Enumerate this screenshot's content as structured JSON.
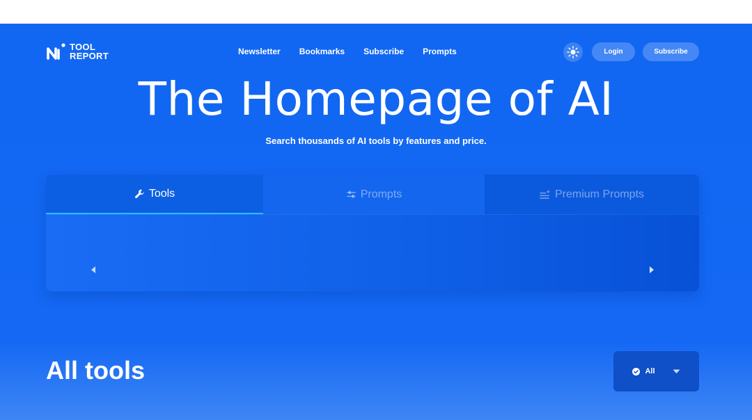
{
  "logo": {
    "line1": "TOOL",
    "line2": "REPORT"
  },
  "nav": [
    "Newsletter",
    "Bookmarks",
    "Subscribe",
    "Prompts"
  ],
  "header": {
    "login_label": "Login",
    "subscribe_label": "Subscribe",
    "theme_icon": "sun-icon"
  },
  "hero": {
    "title": "The Homepage of AI",
    "subtitle": "Search thousands of AI tools by features and price."
  },
  "tabs": [
    {
      "label": "Tools",
      "icon": "wrench-icon",
      "active": true
    },
    {
      "label": "Prompts",
      "icon": "sliders-icon",
      "active": false
    },
    {
      "label": "Premium Prompts",
      "icon": "sparkle-list-icon",
      "active": false
    }
  ],
  "section": {
    "title": "All tools"
  },
  "filter": {
    "selected": "All",
    "icon": "check-circle-icon"
  },
  "colors": {
    "background": "#1167f2",
    "tab_active_underline": "#33b7ff",
    "filter_bg": "#0f4fc8"
  }
}
